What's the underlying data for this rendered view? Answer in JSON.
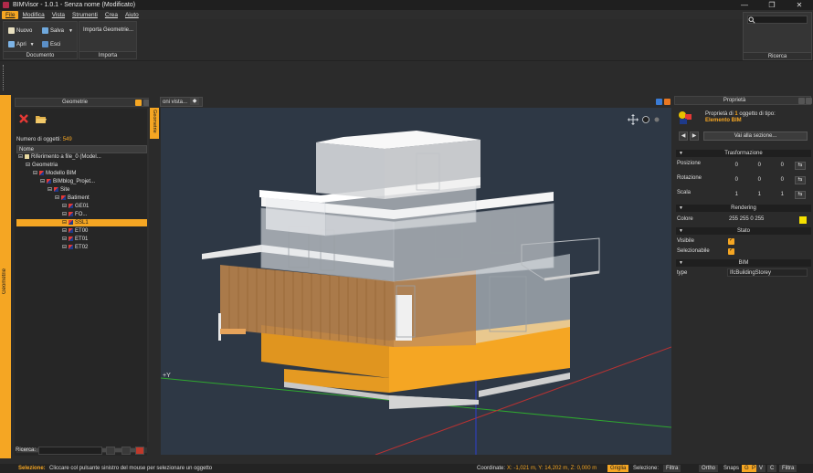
{
  "window": {
    "title": "BIMVisor - 1.0.1 - Senza nome (Modificato)"
  },
  "menu": [
    "File",
    "Modifica",
    "Vista",
    "Strumenti",
    "Crea",
    "Aiuto"
  ],
  "ribbon": {
    "documento": {
      "label": "Documento",
      "nuovo": "Nuovo",
      "salva": "Salva",
      "apri": "Apri",
      "esci": "Esci"
    },
    "importa": {
      "label": "Importa",
      "importa_geometrie": "Importa Geometrie..."
    },
    "ricerca": {
      "label": "Ricerca"
    }
  },
  "left_panel": {
    "side_tab": "Geometrie",
    "header": "Geometrie",
    "object_count_label": "Numero di oggetti:",
    "object_count": "549",
    "column": "Nome",
    "tree": [
      {
        "label": "Riferimento a file_0 (Model...",
        "indent": 0,
        "icon": "file-icon"
      },
      {
        "label": "Geometria",
        "indent": 1,
        "icon": "none"
      },
      {
        "label": "Modello BIM",
        "indent": 2,
        "icon": "bim-icon"
      },
      {
        "label": "BIMblog_Projet...",
        "indent": 3,
        "icon": "bim-icon"
      },
      {
        "label": "Site",
        "indent": 4,
        "icon": "bim-icon"
      },
      {
        "label": "Batiment",
        "indent": 5,
        "icon": "bim-icon"
      },
      {
        "label": "GE01",
        "indent": 6,
        "icon": "bim-icon"
      },
      {
        "label": "FO...",
        "indent": 6,
        "icon": "bim-icon"
      },
      {
        "label": "SSL1",
        "indent": 6,
        "icon": "bim-icon",
        "selected": true
      },
      {
        "label": "ET00",
        "indent": 6,
        "icon": "bim-icon"
      },
      {
        "label": "ET01",
        "indent": 6,
        "icon": "bim-icon"
      },
      {
        "label": "ET02",
        "indent": 6,
        "icon": "bim-icon"
      }
    ],
    "search_label": "Ricerca:"
  },
  "viewport": {
    "tab_label": "oni vista...",
    "side_tab": "Geometrie",
    "axis_label": "+Y"
  },
  "properties": {
    "header": "Proprietà",
    "info_prefix": "Proprietà di",
    "info_count": "1",
    "info_suffix": "oggetto di tipo:",
    "object_type": "Elemento BIM",
    "goto_section": "Vai alla sezione...",
    "sections": {
      "transform": "Trasformazione",
      "rendering": "Rendering",
      "stato": "Stato",
      "bim": "BIM"
    },
    "posizione": {
      "label": "Posizione",
      "values": [
        "0",
        "0",
        "0"
      ]
    },
    "rotazione": {
      "label": "Rotazione",
      "values": [
        "0",
        "0",
        "0"
      ]
    },
    "scala": {
      "label": "Scala",
      "values": [
        "1",
        "1",
        "1"
      ]
    },
    "colore": {
      "label": "Colore",
      "value": "255 255 0 255",
      "swatch": "#f5e000"
    },
    "visibile": {
      "label": "Visibile",
      "checked": true
    },
    "selezionabile": {
      "label": "Selezionabile",
      "checked": true
    },
    "type": {
      "label": "type",
      "value": "IfcBuildingStorey"
    }
  },
  "statusbar": {
    "selection_label": "Selezione:",
    "selection_hint": "Cliccare col pulsante sinistro del mouse per selezionare un oggetto",
    "coords_label": "Coordinate:",
    "coords_value": "X: -1,021 m, Y: 14,202 m, Z: 0,000 m",
    "griglia": "Griglia",
    "selezione": "Selezione:",
    "filtra": "Filtra",
    "ortho": "Ortho",
    "snaps": "Snaps",
    "snap_g": "G",
    "snap_p": "P",
    "snap_v": "V",
    "snap_c": "C",
    "filtra2": "Filtra"
  },
  "colors": {
    "accent": "#f5a623",
    "viewport_bg": "#2e3845",
    "panel_bg": "#2b2b2b"
  }
}
